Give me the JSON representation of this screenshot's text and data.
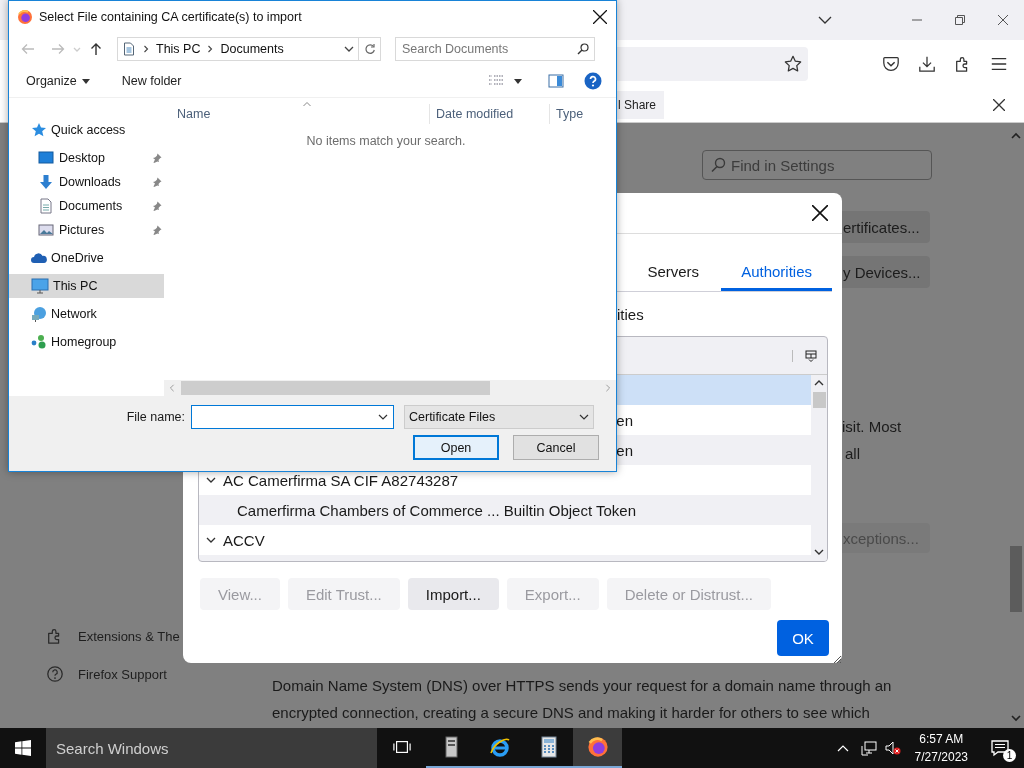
{
  "browser": {
    "notification": {
      "button": "l Share"
    },
    "settings_search": {
      "placeholder": "Find in Settings"
    },
    "side_buttons": [
      "ertificates...",
      "y Devices..."
    ],
    "text_fragments": [
      "isit. Most",
      "all"
    ],
    "exceptions_button": "xceptions...",
    "sidebar": [
      {
        "kind": "extensions",
        "label": "Extensions & The"
      },
      {
        "kind": "support",
        "label": "Firefox Support"
      }
    ],
    "paragraph": "Domain Name System (DNS) over HTTPS sends your request for a domain name through an encrypted connection, creating a secure DNS and making it harder for others to see which"
  },
  "certificate_manager": {
    "tabs": [
      {
        "label": "Servers",
        "selected": false
      },
      {
        "label": "Authorities",
        "selected": true
      }
    ],
    "heading": "ities",
    "rows": [
      {
        "kind": "cert",
        "selected": true
      },
      {
        "kind": "cert",
        "text": "en",
        "selected": false
      },
      {
        "kind": "cert",
        "text": "en",
        "selected": false
      },
      {
        "kind": "group",
        "text": "AC Camerfirma SA CIF A82743287",
        "expanded": true,
        "selected": false
      },
      {
        "kind": "cert",
        "text": "Camerfirma Chambers of Commerce ... Builtin Object Token",
        "selected": false
      },
      {
        "kind": "group",
        "text": "ACCV",
        "expanded": true,
        "selected": false
      }
    ],
    "buttons": [
      {
        "label": "View...",
        "disabled": true
      },
      {
        "label": "Edit Trust...",
        "disabled": true
      },
      {
        "label": "Import...",
        "disabled": false
      },
      {
        "label": "Export...",
        "disabled": true
      },
      {
        "label": "Delete or Distrust...",
        "disabled": true
      }
    ],
    "ok_button": "OK"
  },
  "file_dialog": {
    "title": "Select File containing CA certificate(s) to import",
    "breadcrumb": [
      "This PC",
      "Documents"
    ],
    "search": {
      "placeholder": "Search Documents"
    },
    "toolbar": [
      {
        "kind": "menu",
        "label": "Organize"
      },
      {
        "kind": "button",
        "label": "New folder"
      }
    ],
    "nav": [
      {
        "kind": "quick",
        "label": "Quick access",
        "selected": false,
        "children": [
          {
            "kind": "desktop",
            "label": "Desktop",
            "pinned": true,
            "selected": false
          },
          {
            "kind": "downloads",
            "label": "Downloads",
            "pinned": true,
            "selected": false
          },
          {
            "kind": "documents",
            "label": "Documents",
            "pinned": true,
            "selected": false
          },
          {
            "kind": "pictures",
            "label": "Pictures",
            "pinned": true,
            "selected": false
          }
        ]
      },
      {
        "kind": "onedrive",
        "label": "OneDrive",
        "selected": false
      },
      {
        "kind": "pc",
        "label": "This PC",
        "selected": true
      },
      {
        "kind": "network",
        "label": "Network",
        "selected": false
      },
      {
        "kind": "homegroup",
        "label": "Homegroup",
        "selected": false
      }
    ],
    "columns": [
      "Name",
      "Date modified",
      "Type"
    ],
    "empty_message": "No items match your search.",
    "file_name": {
      "label": "File name:"
    },
    "filter": "Certificate Files",
    "buttons": [
      {
        "label": "Open",
        "default": true
      },
      {
        "label": "Cancel",
        "default": false
      }
    ]
  },
  "taskbar": {
    "search": {
      "placeholder": "Search Windows"
    },
    "apps": [
      {
        "kind": "taskview",
        "running": false,
        "selected": false
      },
      {
        "kind": "server",
        "running": true,
        "selected": false
      },
      {
        "kind": "ie",
        "running": true,
        "selected": false
      },
      {
        "kind": "calculator",
        "running": true,
        "selected": false
      },
      {
        "kind": "firefox",
        "running": true,
        "selected": true
      }
    ],
    "time": "6:57 AM",
    "date": "7/27/2023",
    "notifications": "1"
  }
}
